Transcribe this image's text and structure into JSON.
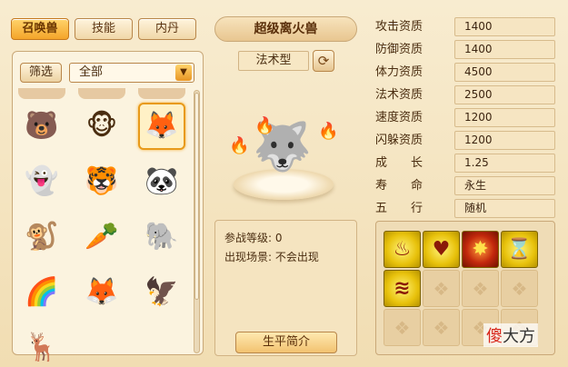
{
  "tabs": [
    {
      "label": "召唤兽",
      "active": true
    },
    {
      "label": "技能",
      "active": false
    },
    {
      "label": "内丹",
      "active": false
    }
  ],
  "filter": {
    "button_label": "筛选",
    "selected": "全部"
  },
  "pet_list": [
    {
      "icon": "pink-bear-icon",
      "glyph": "🐻"
    },
    {
      "icon": "monkey-king-icon",
      "glyph": "🐵"
    },
    {
      "icon": "fire-fox-icon",
      "glyph": "🦊",
      "selected": true
    },
    {
      "icon": "ghost-bow-icon",
      "glyph": "👻"
    },
    {
      "icon": "tiger-icon",
      "glyph": "🐯"
    },
    {
      "icon": "panda-icon",
      "glyph": "🐼"
    },
    {
      "icon": "monkey-icon",
      "glyph": "🐒"
    },
    {
      "icon": "radish-child-icon",
      "glyph": "🥕"
    },
    {
      "icon": "elephant-icon",
      "glyph": "🐘"
    },
    {
      "icon": "rainbow-helmet-icon",
      "glyph": "🌈"
    },
    {
      "icon": "white-fox-icon",
      "glyph": "🦊"
    },
    {
      "icon": "white-phoenix-icon",
      "glyph": "🦅"
    },
    {
      "icon": "golden-deer-icon",
      "glyph": "🦌"
    }
  ],
  "pet": {
    "name": "超级离火兽",
    "type": "法术型",
    "battle_level_label": "参战等级:",
    "battle_level": "0",
    "scene_label": "出现场景:",
    "scene": "不会出现",
    "bio_button": "生平简介"
  },
  "stats": [
    {
      "label": "攻击资质",
      "value": "1400"
    },
    {
      "label": "防御资质",
      "value": "1400"
    },
    {
      "label": "体力资质",
      "value": "4500"
    },
    {
      "label": "法术资质",
      "value": "2500"
    },
    {
      "label": "速度资质",
      "value": "1200"
    },
    {
      "label": "闪躲资质",
      "value": "1200"
    },
    {
      "label": "成　　长",
      "value": "1.25"
    },
    {
      "label": "寿　　命",
      "value": "永生"
    },
    {
      "label": "五　　行",
      "value": "随机"
    }
  ],
  "skills": [
    {
      "icon": "flame-skill-icon",
      "glyph": "♨",
      "style": "yellow"
    },
    {
      "icon": "heart-flame-skill-icon",
      "glyph": "♥",
      "style": "yellow"
    },
    {
      "icon": "burst-skill-icon",
      "glyph": "✸",
      "style": "red"
    },
    {
      "icon": "hourglass-skill-icon",
      "glyph": "⌛",
      "style": "yellow"
    },
    {
      "icon": "wave-skill-icon",
      "glyph": "≋",
      "style": "yellow"
    }
  ],
  "watermark": {
    "part1": "傻",
    "part2": "大方"
  }
}
